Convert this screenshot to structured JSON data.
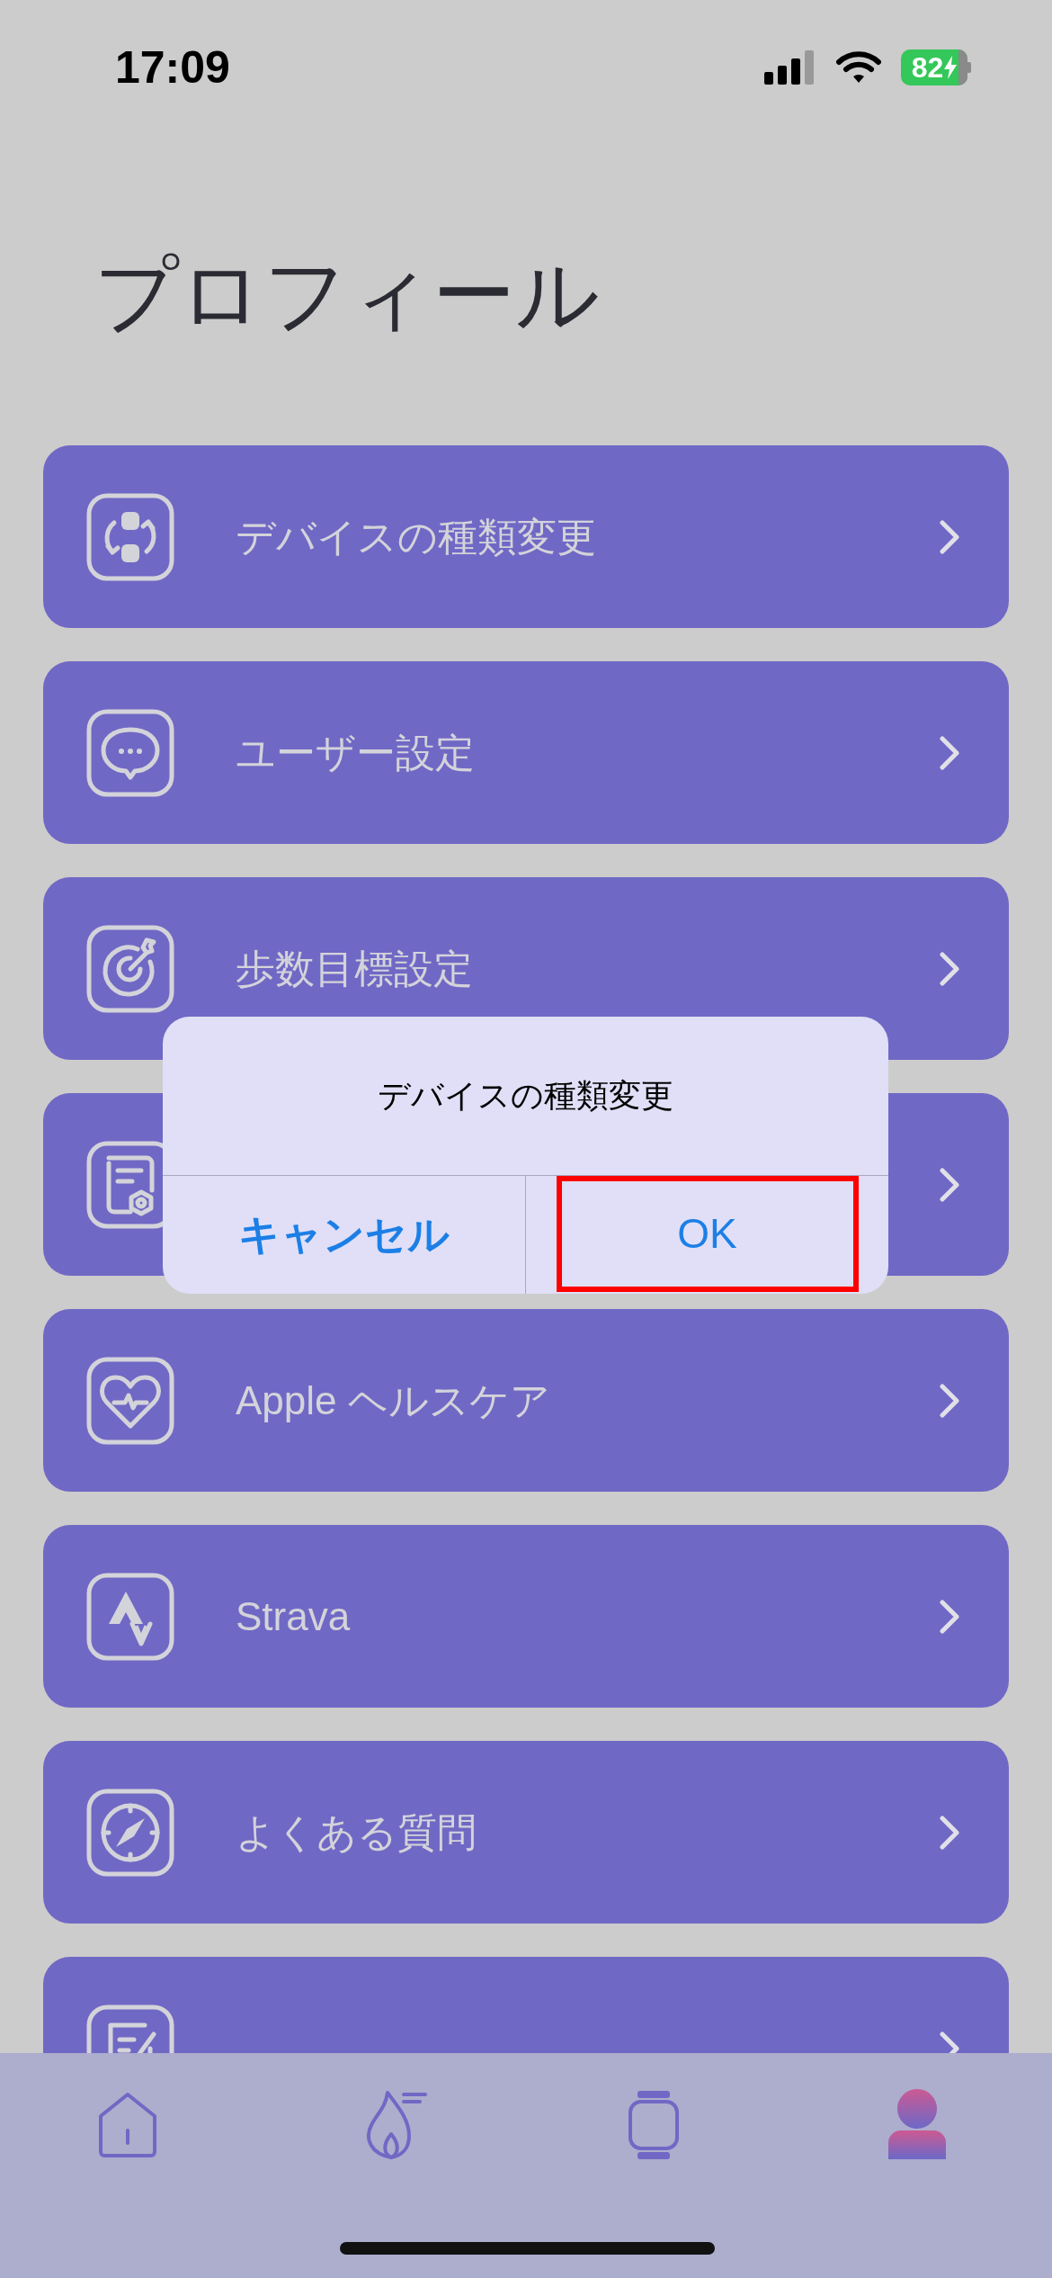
{
  "status_bar": {
    "time": "17:09",
    "battery": "82"
  },
  "title": "プロフィール",
  "menu_items": [
    {
      "kind": "swap",
      "label": "デバイスの種類変更"
    },
    {
      "kind": "chat",
      "label": "ユーザー設定"
    },
    {
      "kind": "target",
      "label": "歩数目標設定"
    },
    {
      "kind": "document"
    },
    {
      "kind": "heart",
      "label": "Apple ヘルスケア"
    },
    {
      "kind": "strava",
      "label": "Strava"
    },
    {
      "kind": "compass",
      "label": "よくある質問"
    },
    {
      "kind": "edit"
    }
  ],
  "dialog": {
    "title": "デバイスの種類変更",
    "buttons": [
      {
        "label": "キャンセル",
        "kind": "cancel",
        "highlighted": false
      },
      {
        "label": "OK",
        "kind": "default",
        "highlighted": true
      }
    ]
  },
  "tab_bar": [
    {
      "kind": "home",
      "selected": false
    },
    {
      "kind": "flame",
      "selected": false
    },
    {
      "kind": "watch",
      "selected": false
    },
    {
      "kind": "profile",
      "selected": true
    }
  ]
}
